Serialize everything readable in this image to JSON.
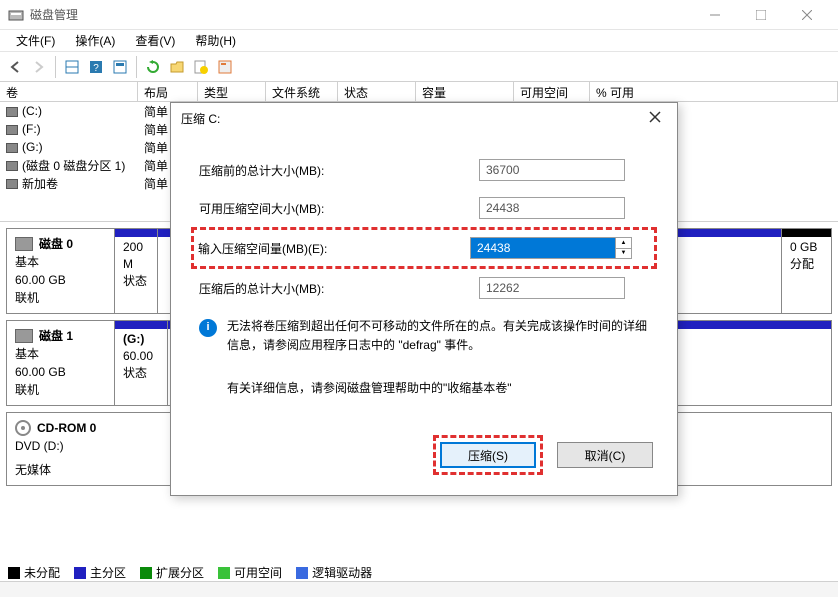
{
  "window": {
    "title": "磁盘管理"
  },
  "menu": {
    "file": "文件(F)",
    "action": "操作(A)",
    "view": "查看(V)",
    "help": "帮助(H)"
  },
  "columns": {
    "volume": "卷",
    "layout": "布局",
    "type": "类型",
    "fs": "文件系统",
    "status": "状态",
    "capacity": "容量",
    "free": "可用空间",
    "pctfree": "% 可用"
  },
  "volumes": [
    {
      "name": "(C:)",
      "layout": "简单"
    },
    {
      "name": "(F:)",
      "layout": "简单"
    },
    {
      "name": "(G:)",
      "layout": "简单"
    },
    {
      "name": "(磁盘 0 磁盘分区 1)",
      "layout": "简单"
    },
    {
      "name": "新加卷",
      "layout": "简单"
    }
  ],
  "disks": {
    "d0": {
      "title": "磁盘 0",
      "type": "基本",
      "size": "60.00 GB",
      "status": "联机",
      "p0_size": "200 M",
      "p0_status": "状态",
      "p1_right_size": "0 GB",
      "p1_right_status": "分配"
    },
    "d1": {
      "title": "磁盘 1",
      "type": "基本",
      "size": "60.00 GB",
      "status": "联机",
      "p0_name": "(G:)",
      "p0_size": "60.00",
      "p0_status": "状态"
    },
    "cd": {
      "title": "CD-ROM 0",
      "type": "DVD (D:)",
      "status": "无媒体"
    }
  },
  "legend": {
    "unalloc": "未分配",
    "primary": "主分区",
    "extended": "扩展分区",
    "free": "可用空间",
    "logical": "逻辑驱动器"
  },
  "dialog": {
    "title": "压缩 C:",
    "row1_label": "压缩前的总计大小(MB):",
    "row1_value": "36700",
    "row2_label": "可用压缩空间大小(MB):",
    "row2_value": "24438",
    "row3_label": "输入压缩空间量(MB)(E):",
    "row3_value": "24438",
    "row4_label": "压缩后的总计大小(MB):",
    "row4_value": "12262",
    "info1": "无法将卷压缩到超出任何不可移动的文件所在的点。有关完成该操作时间的详细信息，请参阅应用程序日志中的 \"defrag\" 事件。",
    "info2": "有关详细信息，请参阅磁盘管理帮助中的\"收缩基本卷\"",
    "btn_shrink": "压缩(S)",
    "btn_cancel": "取消(C)"
  }
}
